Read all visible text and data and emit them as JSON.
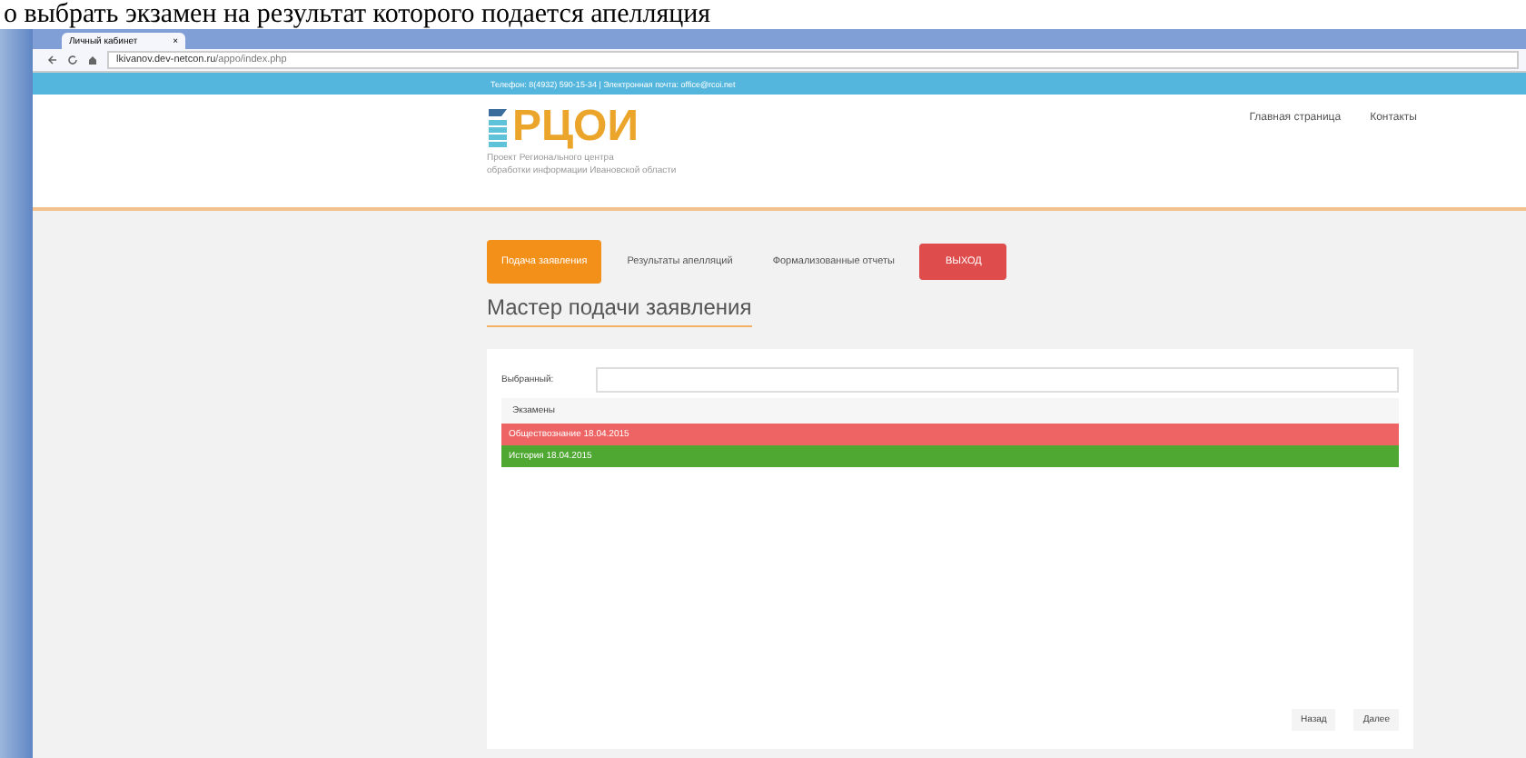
{
  "document_caption": "о выбрать экзамен на результат которого подается апелляция",
  "browser": {
    "tab_title": "Личный кабинет",
    "tab_close": "×",
    "url_host": "lkivanov.dev-netcon.ru",
    "url_path": "/appo/index.php"
  },
  "top_bar": {
    "text": "Телефон: 8(4932) 590-15-34 | Электронная почта: office@rcoi.net"
  },
  "header": {
    "logo_text": "РЦОИ",
    "logo_subtitle": [
      "Проект Регионального центра",
      "обработки информации Ивановской области"
    ],
    "nav": [
      "Главная страница",
      "Контакты"
    ]
  },
  "tabs": [
    {
      "label": "Подача заявления",
      "kind": "tab",
      "selected": true
    },
    {
      "label": "Результаты апелляций",
      "kind": "tab",
      "selected": false
    },
    {
      "label": "Формализованные отчеты",
      "kind": "tab",
      "selected": false
    },
    {
      "label": "ВЫХОД",
      "kind": "logout"
    }
  ],
  "page_title": "Мастер подачи заявления",
  "form": {
    "selected_label": "Выбранный:",
    "list_header": "Экзамены",
    "exams": [
      {
        "label": "Обществознание 18.04.2015",
        "color": "#ee6464"
      },
      {
        "label": "История 18.04.2015",
        "color": "#4fa832"
      }
    ],
    "buttons": [
      "Назад",
      "Далее"
    ]
  }
}
